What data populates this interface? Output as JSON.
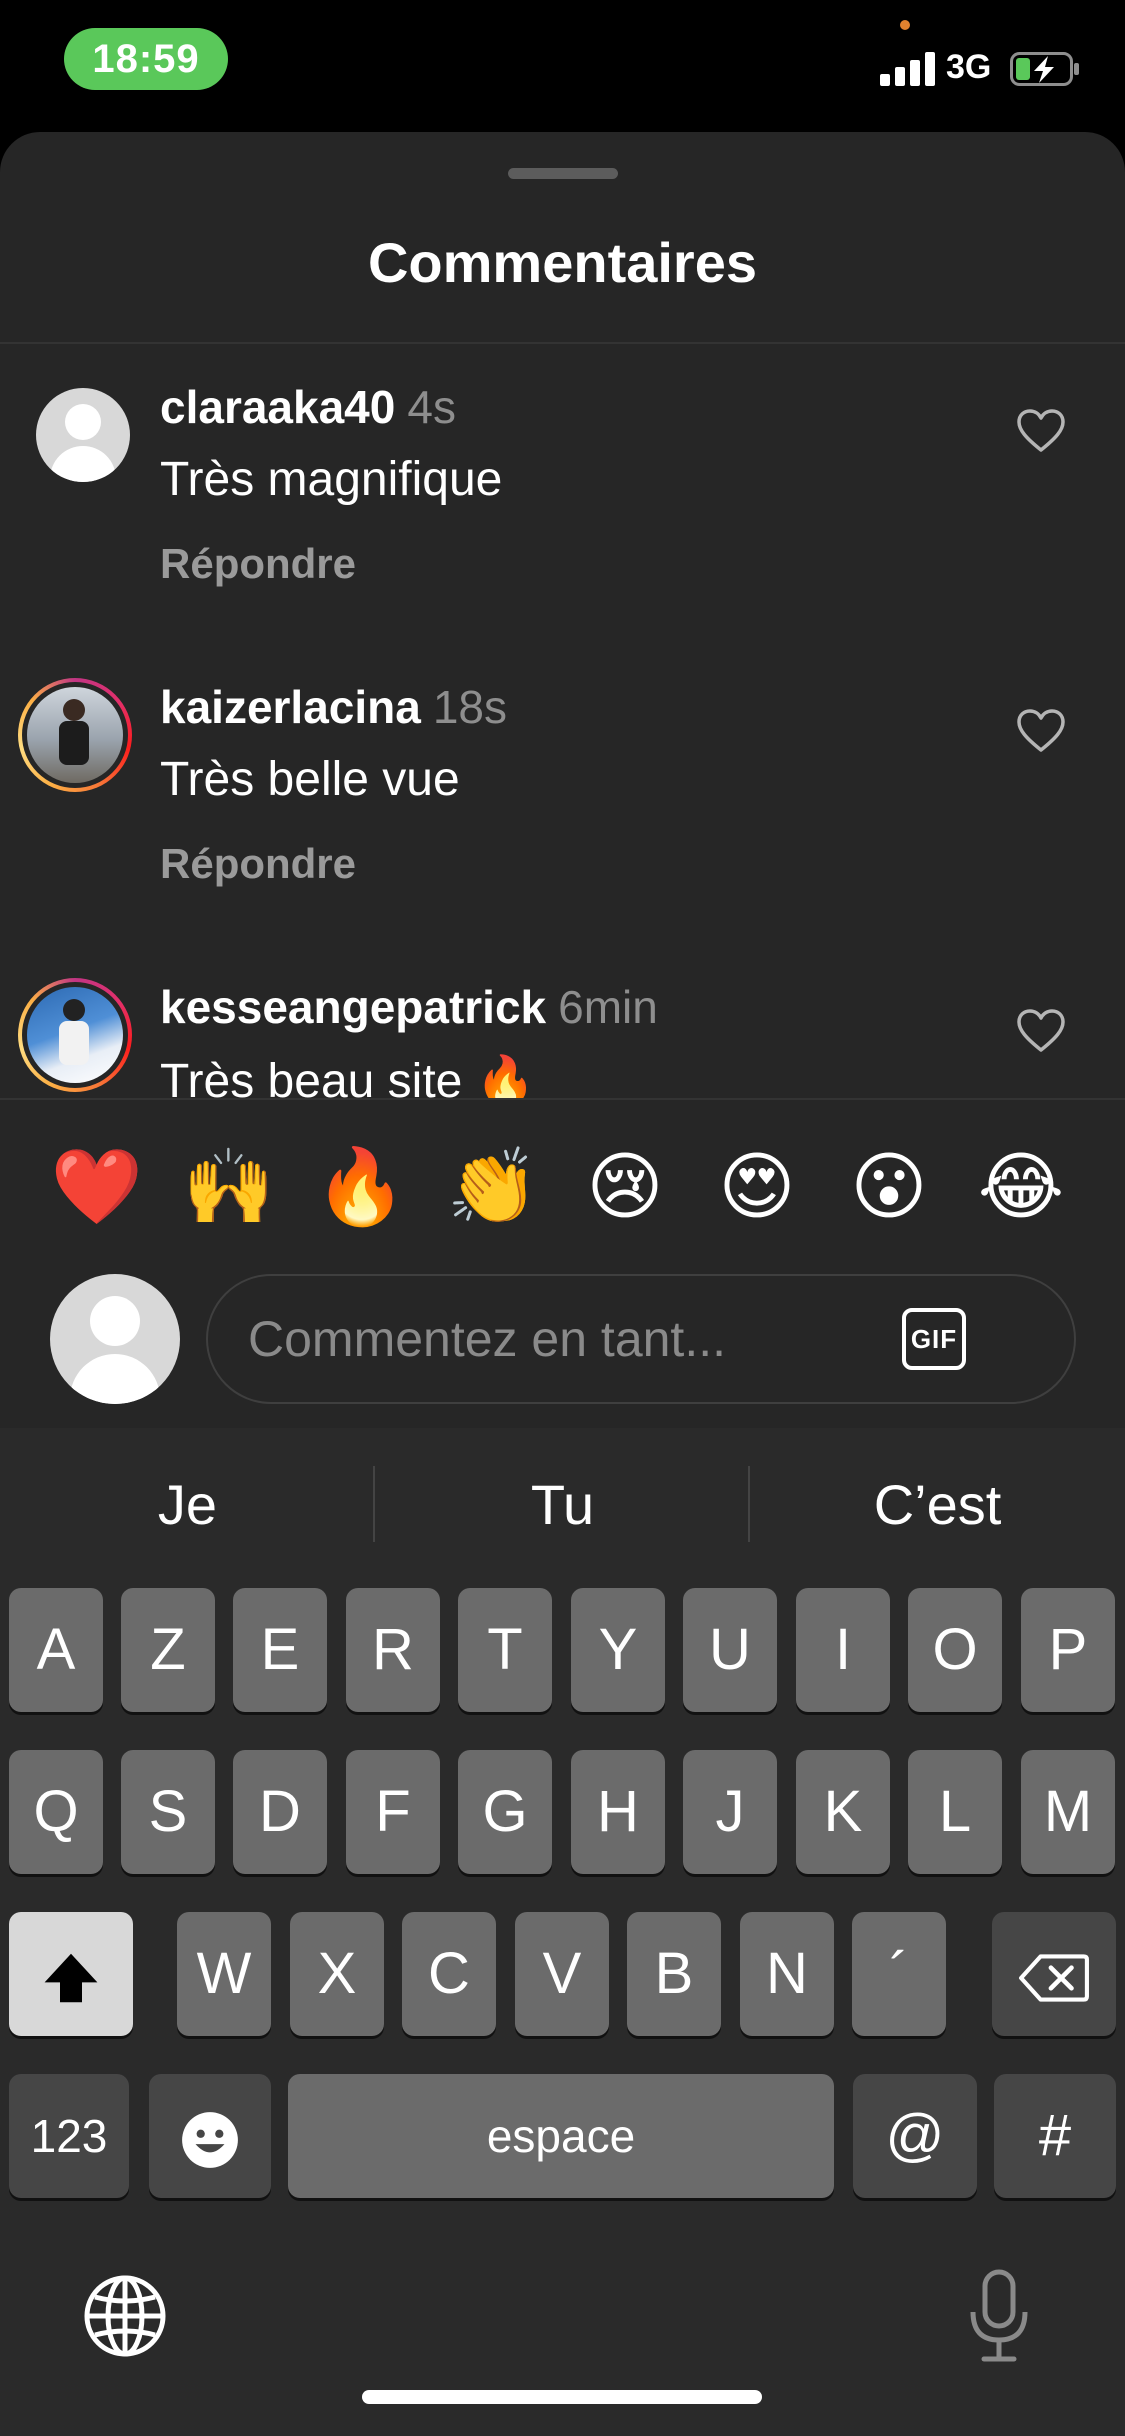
{
  "status_bar": {
    "time": "18:59",
    "network": "3G",
    "colors": {
      "time_pill": "#5ac85a",
      "recording_dot": "#e0822f"
    }
  },
  "sheet": {
    "title": "Commentaires"
  },
  "comments": [
    {
      "username": "claraaka40",
      "time": "4s",
      "text": "Très magnifique",
      "reply": "Répondre",
      "avatar": "default"
    },
    {
      "username": "kaizerlacina",
      "time": "18s",
      "text": "Très belle vue",
      "reply": "Répondre",
      "avatar": "photo-with-story-ring"
    },
    {
      "username": "kesseangepatrick",
      "time": "6min",
      "text": "Très beau site 🔥",
      "avatar": "photo-with-story-ring"
    }
  ],
  "quick_reactions": [
    "❤️",
    "🙌",
    "🔥",
    "👏",
    "😢",
    "😍",
    "😮",
    "😂"
  ],
  "composer": {
    "placeholder": "Commentez en tant...",
    "gif_label": "GIF"
  },
  "keyboard": {
    "suggestions": [
      "Je",
      "Tu",
      "C’est"
    ],
    "row1": [
      "A",
      "Z",
      "E",
      "R",
      "T",
      "Y",
      "U",
      "I",
      "O",
      "P"
    ],
    "row2": [
      "Q",
      "S",
      "D",
      "F",
      "G",
      "H",
      "J",
      "K",
      "L",
      "M"
    ],
    "row3": [
      "W",
      "X",
      "C",
      "V",
      "B",
      "N",
      "´"
    ],
    "numbers_key": "123",
    "space_key": "espace",
    "at_key": "@",
    "hash_key": "#"
  }
}
